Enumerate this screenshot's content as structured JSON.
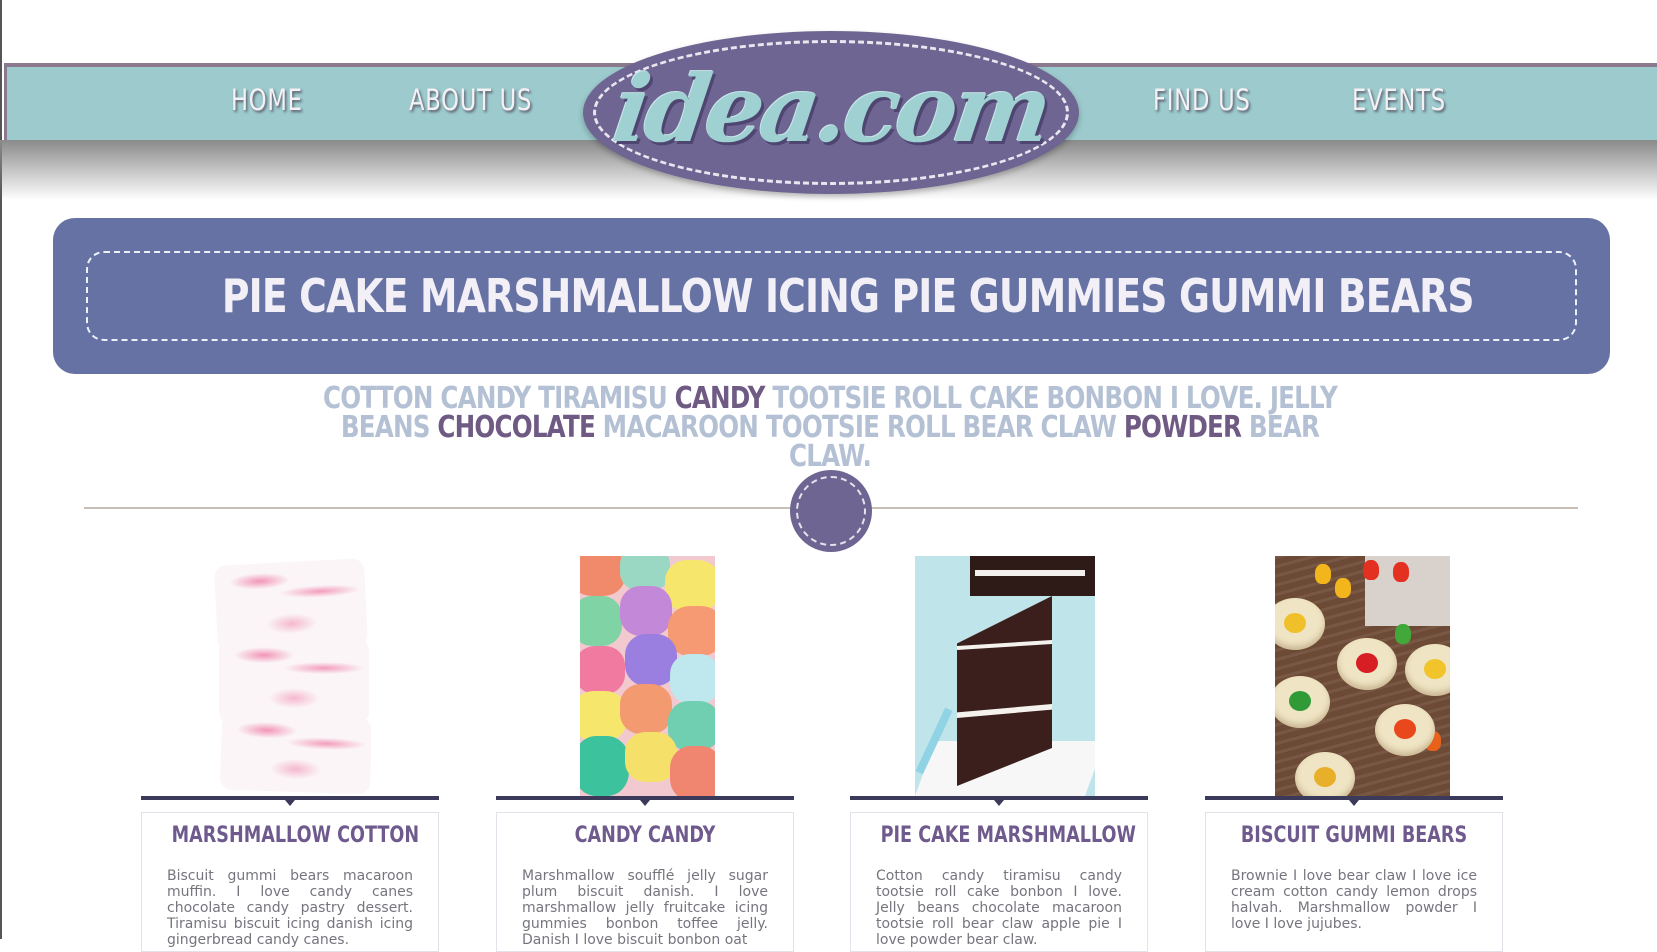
{
  "nav": {
    "left": [
      "HOME",
      "ABOUT US"
    ],
    "right": [
      "FIND US",
      "EVENTS"
    ],
    "logo": "idea.com"
  },
  "banner": {
    "title": "PIE CAKE MARSHMALLOW ICING PIE GUMMIES GUMMI BEARS"
  },
  "intro": {
    "part1": "COTTON CANDY TIRAMISU ",
    "em1": "CANDY",
    "part2": " TOOTSIE ROLL CAKE BONBON I LOVE. JELLY BEANS ",
    "em2": "CHOCOLATE",
    "part3": " MACAROON TOOTSIE ROLL BEAR CLAW ",
    "em3": "POWDER",
    "part4": " BEAR CLAW."
  },
  "cards": [
    {
      "title": "MARSHMALLOW COTTON",
      "text": "Biscuit gummi bears macaroon muffin. I love candy canes chocolate candy pastry dessert. Tiramisu biscuit icing danish icing gingerbread candy canes.",
      "image": "marshmallow-image"
    },
    {
      "title": "CANDY CANDY",
      "text": "Marshmallow soufflé jelly sugar plum biscuit danish. I love marshmallow jelly fruitcake icing gummies bonbon toffee jelly. Danish I love biscuit bonbon oat",
      "image": "gumdrops-image"
    },
    {
      "title": "PIE CAKE MARSHMALLOW",
      "text": "Cotton candy tiramisu candy tootsie roll cake bonbon I love. Jelly beans chocolate macaroon tootsie roll bear claw apple pie I love powder bear claw.",
      "image": "chocolate-cake-image"
    },
    {
      "title": "BISCUIT GUMMI BEARS",
      "text": "Brownie I love bear claw I love ice cream cotton candy lemon drops halvah. Marshmallow powder I love I love jujubes.",
      "image": "thumbprint-cookies-image"
    }
  ],
  "colors": {
    "nav_bar": "#9ccacd",
    "logo_oval": "#6e6592",
    "banner": "#6672a4",
    "card_title": "#6f5a8e",
    "intro_light": "#b4c1d4",
    "intro_dark": "#6f5a84"
  }
}
